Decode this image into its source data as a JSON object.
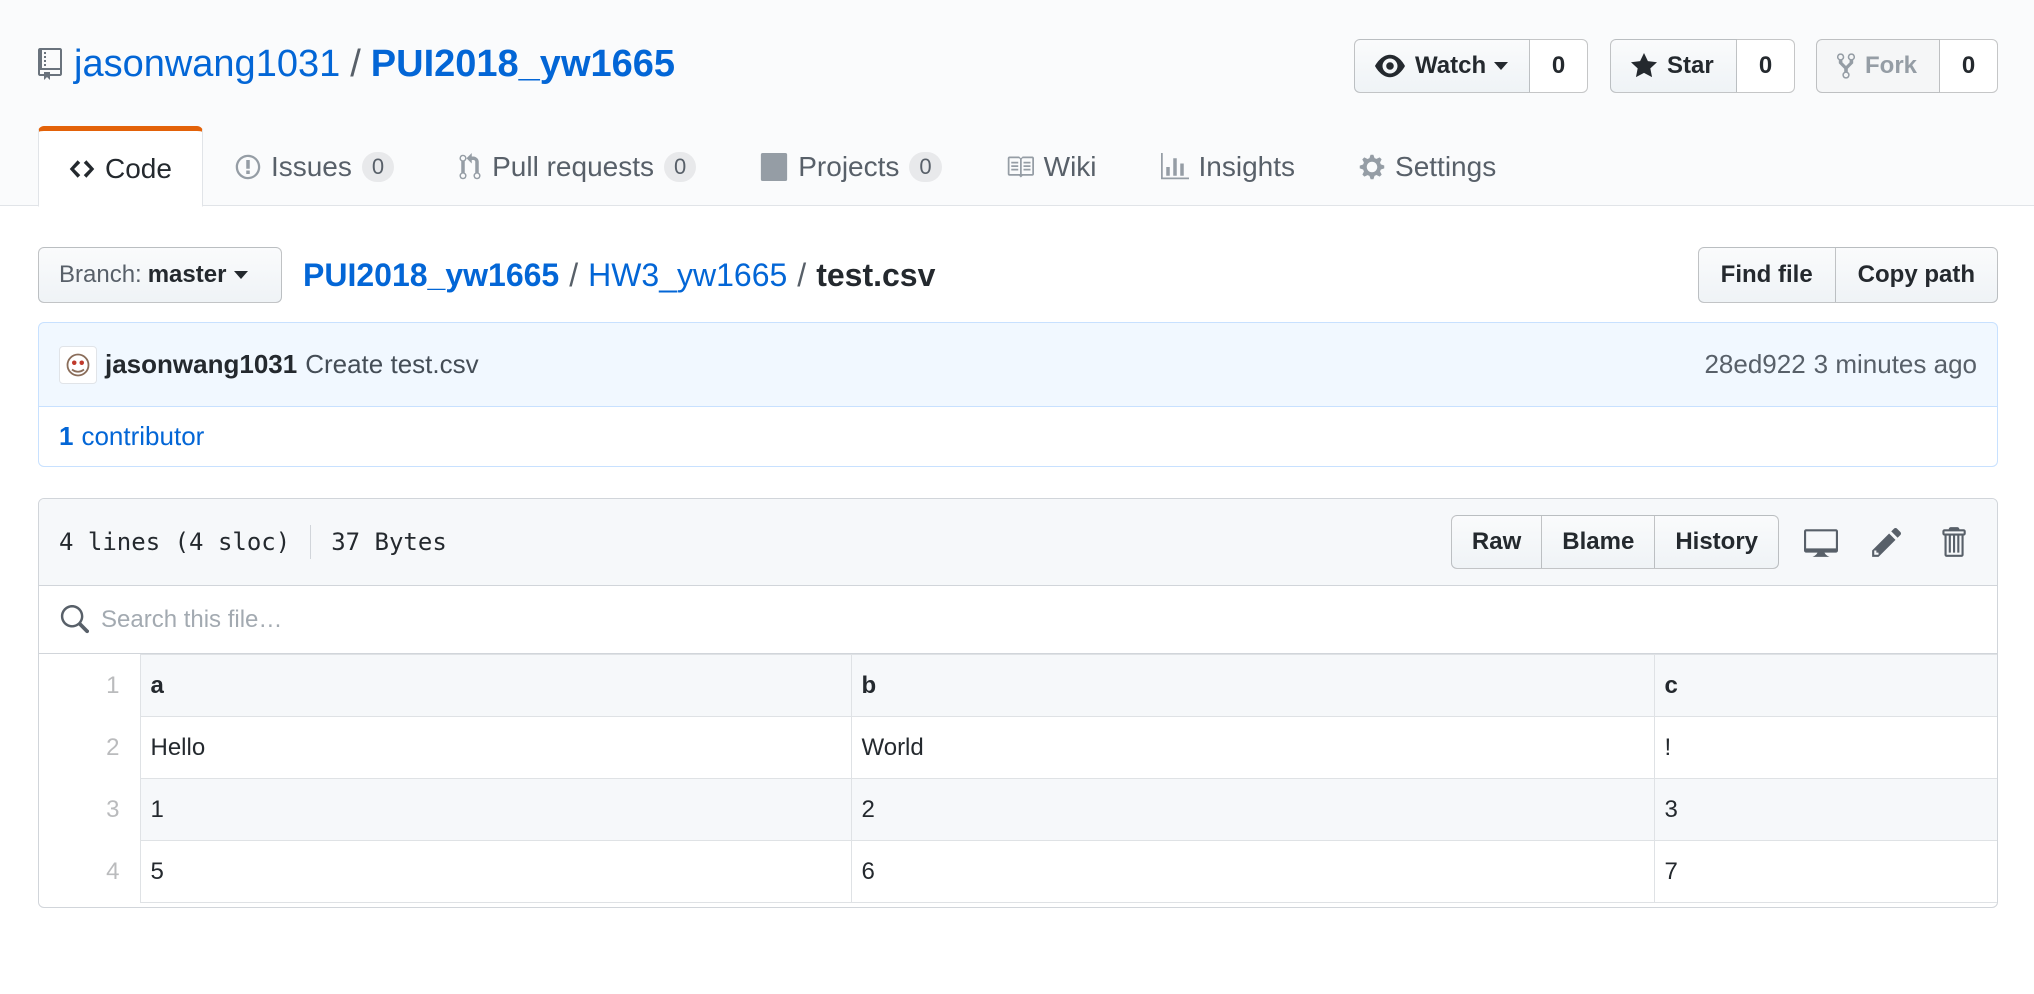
{
  "repo": {
    "owner": "jasonwang1031",
    "separator": "/",
    "name": "PUI2018_yw1665"
  },
  "actions": {
    "watch": {
      "label": "Watch",
      "count": "0"
    },
    "star": {
      "label": "Star",
      "count": "0"
    },
    "fork": {
      "label": "Fork",
      "count": "0"
    }
  },
  "tabs": [
    {
      "label": "Code",
      "icon": "code-icon",
      "selected": true
    },
    {
      "label": "Issues",
      "icon": "issue-icon",
      "count": "0"
    },
    {
      "label": "Pull requests",
      "icon": "pull-request-icon",
      "count": "0"
    },
    {
      "label": "Projects",
      "icon": "project-icon",
      "count": "0"
    },
    {
      "label": "Wiki",
      "icon": "book-icon"
    },
    {
      "label": "Insights",
      "icon": "graph-icon"
    },
    {
      "label": "Settings",
      "icon": "gear-icon"
    }
  ],
  "branch": {
    "prefix": "Branch:",
    "name": "master"
  },
  "breadcrumb": {
    "root": "PUI2018_yw1665",
    "dir": "HW3_yw1665",
    "file": "test.csv",
    "separator": "/"
  },
  "file_nav": {
    "find_file": "Find file",
    "copy_path": "Copy path"
  },
  "commit": {
    "author": "jasonwang1031",
    "message": "Create test.csv",
    "sha": "28ed922",
    "time": "3 minutes ago"
  },
  "contributors": {
    "count": "1",
    "label": "contributor"
  },
  "file": {
    "lines": "4 lines (4 sloc)",
    "size": "37 Bytes",
    "buttons": {
      "raw": "Raw",
      "blame": "Blame",
      "history": "History"
    },
    "search_placeholder": "Search this file…"
  },
  "csv": {
    "header": {
      "line": "1",
      "cells": [
        "a",
        "b",
        "c"
      ]
    },
    "rows": [
      {
        "line": "2",
        "cells": [
          "Hello",
          "World",
          "!"
        ]
      },
      {
        "line": "3",
        "cells": [
          "1",
          "2",
          "3"
        ]
      },
      {
        "line": "4",
        "cells": [
          "5",
          "6",
          "7"
        ]
      }
    ]
  },
  "colors": {
    "link": "#0366d6",
    "selected_tab_accent": "#e36209",
    "commit_bg": "#f1f8ff"
  }
}
